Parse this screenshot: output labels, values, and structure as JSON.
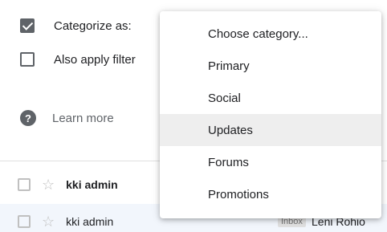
{
  "filter_options": {
    "categorize_label": "Categorize as:",
    "categorize_checked": true,
    "also_apply_label": "Also apply filter",
    "also_apply_checked": false,
    "learn_more_label": "Learn more"
  },
  "icons": {
    "help": "question-circle-icon",
    "star": "star-outline-icon"
  },
  "dropdown": {
    "items": [
      "Choose category...",
      "Primary",
      "Social",
      "Updates",
      "Forums",
      "Promotions"
    ],
    "highlighted_item": "Updates"
  },
  "mail_rows": [
    {
      "sender": "kki admin",
      "unread": true
    },
    {
      "sender": "kki admin",
      "unread": false,
      "label": "Inbox",
      "subject": "Leni Rohio"
    }
  ],
  "colors": {
    "checkbox": "#5f6368",
    "highlight": "#eeeeee",
    "read_row_bg": "#f2f6fc"
  }
}
